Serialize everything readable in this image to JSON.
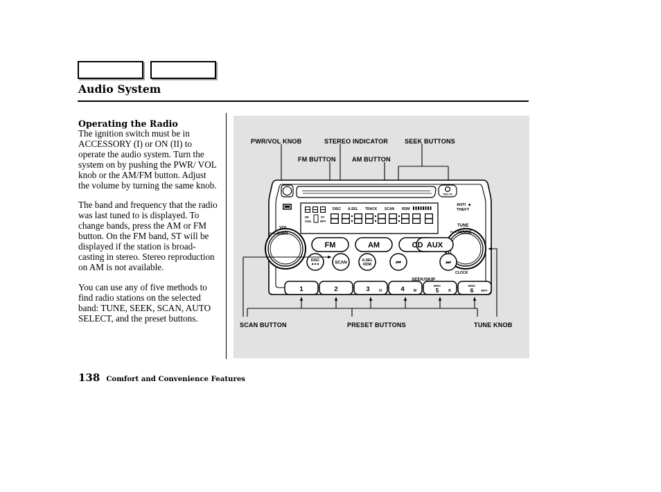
{
  "page": {
    "title": "Audio System",
    "number": "138",
    "footer_text": "Comfort and Convenience Features"
  },
  "tabs": [
    {
      "label": ""
    },
    {
      "label": ""
    }
  ],
  "body": {
    "heading": "Operating the Radio",
    "paragraphs": [
      "The ignition switch must be in ACCESSORY (I) or ON (II) to operate the audio system. Turn the system on by pushing the PWR/ VOL knob or the AM/FM button. Adjust the volume by turning the same knob.",
      "The band and frequency that the radio was last tuned to is displayed. To change bands, press the AM or FM button. On the FM band, ST will be displayed if the station is broad-casting in stereo. Stereo reproduction on AM is not available.",
      "You can use any of five methods to find radio stations on the selected band: TUNE, SEEK, SCAN, AUTO SELECT, and the preset buttons."
    ]
  },
  "figure": {
    "background_color": "#e2e2e2",
    "callouts_top": [
      {
        "id": "pwr-vol-knob",
        "label": "PWR/VOL KNOB"
      },
      {
        "id": "stereo-indicator",
        "label": "STEREO INDICATOR"
      },
      {
        "id": "seek-buttons",
        "label": "SEEK BUTTONS"
      },
      {
        "id": "fm-button",
        "label": "FM BUTTON"
      },
      {
        "id": "am-button",
        "label": "AM BUTTON"
      }
    ],
    "callouts_bottom": [
      {
        "id": "scan-button",
        "label": "SCAN BUTTON"
      },
      {
        "id": "preset-buttons",
        "label": "PRESET BUTTONS"
      },
      {
        "id": "tune-knob",
        "label": "TUNE KNOB"
      }
    ],
    "radio": {
      "eject_icon": "eject-icon",
      "disc_in_label": "DISC IN",
      "anti_theft_label": "ANTI✦\nTHEFT",
      "anti_theft_line1": "ANTI",
      "anti_theft_line2": "THEFT",
      "left_knob": {
        "line1": "VOL",
        "push": "Push",
        "line2": "PWR"
      },
      "right_knob": {
        "line1": "TUNE",
        "push": "Push",
        "line2": "MODE",
        "below": "CLOCK"
      },
      "display": {
        "indicators_top": [
          "DISC",
          "A.SEL",
          "TRACK",
          "SCAN",
          "RDM"
        ],
        "indicators_left": [
          "DE",
          "CHG",
          "ST",
          "RPT"
        ],
        "segments": "88:88888888"
      },
      "source_buttons": [
        {
          "label": "FM"
        },
        {
          "label": "AM"
        },
        {
          "label": "CD"
        },
        {
          "label": "AUX"
        }
      ],
      "round_buttons": [
        {
          "label": "DISC"
        },
        {
          "label": "SCAN"
        },
        {
          "label": "A.SEL",
          "sub": "RDM"
        },
        {
          "label": "◀◀"
        },
        {
          "label": "▶▶"
        }
      ],
      "seek_skip_label": "SEEK/SKIP",
      "presets": [
        {
          "num": "1",
          "sub": ""
        },
        {
          "num": "2",
          "sub": ""
        },
        {
          "num": "3",
          "sub": "H"
        },
        {
          "num": "4",
          "sub": "M"
        },
        {
          "num": "5",
          "sub": "R",
          "top": "DISC"
        },
        {
          "num": "6",
          "sub": "RPT",
          "top": "DISC"
        }
      ]
    }
  }
}
